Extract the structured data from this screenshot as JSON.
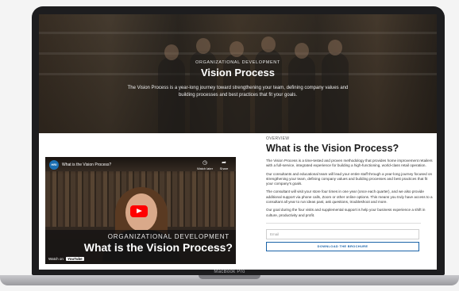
{
  "laptop": {
    "bezel_label": "MacBook Pro"
  },
  "hero": {
    "eyebrow": "ORGANIZATIONAL DEVELOPMENT",
    "title": "Vision Process",
    "description": "The Vision Process is a year-long journey toward strengthening your team, defining company values and building processes and best practices that fit your goals."
  },
  "video": {
    "title": "What is the Vision Process?",
    "watch_later": "Watch later",
    "share": "Share",
    "overlay_eyebrow": "ORGANIZATIONAL DEVELOPMENT",
    "overlay_title": "What is the Vision Process?",
    "watch_on": "Watch on",
    "youtube": "YouTube",
    "play_color": "#ff0000"
  },
  "overview": {
    "eyebrow": "OVERVIEW",
    "title": "What is the Vision Process?",
    "paragraphs": [
      "The Vision Process is a time-tested and proven methodology that provides home improvement retailers with a full-service, integrated experience for building a high-functioning, world-class retail operation.",
      "Our consultants and educational team will lead your entire staff through a year-long journey focused on strengthening your team, defining company values and building processes and best practices that fit your company's goals.",
      "The consultant will visit your store four times in one year (once each quarter), and we also provide additional support via phone calls, Zoom or other online options. This means you truly have access to a consultant all year to run ideas past, ask questions, troubleshoot and more.",
      "Our goal during the four visits and supplemental support is help your business experience a shift in culture, productivity and profit."
    ]
  },
  "form": {
    "email_placeholder": "Email",
    "download_label": "DOWNLOAD THE BROCHURE",
    "accent_color": "#1a63a8"
  }
}
